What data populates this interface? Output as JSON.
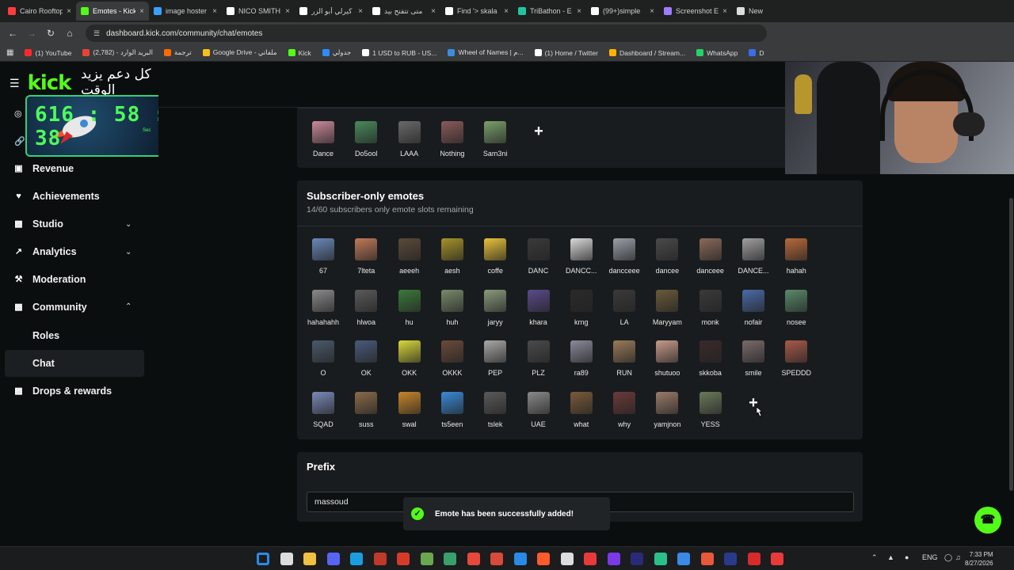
{
  "browser": {
    "tabs": [
      {
        "label": "Cairo Rooftop",
        "color": "#ff3b3b",
        "active": false
      },
      {
        "label": "Emotes - Kick",
        "color": "#53fc18",
        "active": true
      },
      {
        "label": "image hoster",
        "color": "#3aa0ff",
        "active": false
      },
      {
        "label": "NICO SMITH",
        "color": "#ffffff",
        "active": false
      },
      {
        "label": "كيرلي أبو الزر",
        "color": "#ffffff",
        "active": false
      },
      {
        "label": "متى تتفتح بيد",
        "color": "#ffffff",
        "active": false
      },
      {
        "label": "Find '> skala",
        "color": "#ffffff",
        "active": false
      },
      {
        "label": "TriBathon - E",
        "color": "#20c4a0",
        "active": false
      },
      {
        "label": "(99+)simple",
        "color": "#ffffff",
        "active": false
      },
      {
        "label": "Screenshot E",
        "color": "#a07cff",
        "active": false
      },
      {
        "label": "New",
        "color": "#dddddd",
        "active": false
      }
    ],
    "url": "dashboard.kick.com/community/chat/emotes",
    "bookmarks": [
      {
        "label": "(1) YouTube",
        "color": "#ff2a2a"
      },
      {
        "label": "(2,782) - البريد الوارد",
        "color": "#ea4335"
      },
      {
        "label": "ترجمة",
        "color": "#ff6a00"
      },
      {
        "label": "Google Drive - ملفاتي",
        "color": "#f7c11a"
      },
      {
        "label": "Kick",
        "color": "#53fc18"
      },
      {
        "label": "جدولي",
        "color": "#2d8cff"
      },
      {
        "label": "1 USD to RUB - US...",
        "color": "#ffffff"
      },
      {
        "label": "Wheel of Names | م...",
        "color": "#3a8dde"
      },
      {
        "label": "(1) Home / Twitter",
        "color": "#ffffff"
      },
      {
        "label": "Dashboard / Stream...",
        "color": "#ffb400"
      },
      {
        "label": "WhatsApp",
        "color": "#25d366"
      },
      {
        "label": "D",
        "color": "#3a6ee8"
      }
    ]
  },
  "sidebar": {
    "logo": "kick",
    "overlay_text": "كل دعم يزيد الوقت",
    "timer": {
      "digits": "616 : 58 : 38",
      "sec_label": "Sec"
    },
    "items": [
      {
        "label": "Revenue",
        "icon": "dollar-icon"
      },
      {
        "label": "Achievements",
        "icon": "trophy-icon"
      },
      {
        "label": "Studio",
        "icon": "video-icon"
      },
      {
        "label": "Analytics",
        "icon": "chart-icon"
      },
      {
        "label": "Moderation",
        "icon": "hammer-icon"
      },
      {
        "label": "Community",
        "icon": "users-icon"
      },
      {
        "label": "Drops & rewards",
        "icon": "gift-icon"
      }
    ],
    "community_sub": [
      "Roles",
      "Chat"
    ]
  },
  "top_emotes": [
    {
      "name": "Dance",
      "color": "#c98a9a"
    },
    {
      "name": "Do5ool",
      "color": "#4a8a5a"
    },
    {
      "name": "LAAA",
      "color": "#6a6a6a"
    },
    {
      "name": "Nothing",
      "color": "#8a5a5a"
    },
    {
      "name": "Sam3ni",
      "color": "#7aa06a"
    }
  ],
  "subscriber_panel": {
    "title": "Subscriber-only emotes",
    "subtitle": "14/60 subscribers only emote slots remaining",
    "emotes": [
      {
        "name": "67",
        "color": "#6a88b8"
      },
      {
        "name": "7lteta",
        "color": "#c07a5a"
      },
      {
        "name": "aeeeh",
        "color": "#5a4a3a"
      },
      {
        "name": "aesh",
        "color": "#a8922a"
      },
      {
        "name": "coffe",
        "color": "#e8c23a"
      },
      {
        "name": "DANC",
        "color": "#3a3a3a"
      },
      {
        "name": "DANCC...",
        "color": "#d8d8d8"
      },
      {
        "name": "dancceee",
        "color": "#9aa0a8"
      },
      {
        "name": "dancee",
        "color": "#4a4a4a"
      },
      {
        "name": "danceee",
        "color": "#8a6a5a"
      },
      {
        "name": "DANCE...",
        "color": "#a0a0a0"
      },
      {
        "name": "hahah",
        "color": "#b86a3a"
      },
      {
        "name": "hahahahh",
        "color": "#8a8a8a"
      },
      {
        "name": "hlwoa",
        "color": "#5a5a5a"
      },
      {
        "name": "hu",
        "color": "#3a7a3a"
      },
      {
        "name": "huh",
        "color": "#7a8a6a"
      },
      {
        "name": "jaryy",
        "color": "#8a9a7a"
      },
      {
        "name": "khara",
        "color": "#5a4a8a"
      },
      {
        "name": "krng",
        "color": "#2a2a2a"
      },
      {
        "name": "LA",
        "color": "#3a3a3a"
      },
      {
        "name": "Maryyam",
        "color": "#6a5a3a"
      },
      {
        "name": "monk",
        "color": "#3a3a3a"
      },
      {
        "name": "nofair",
        "color": "#4a6aa8"
      },
      {
        "name": "nosee",
        "color": "#5a8a6a"
      },
      {
        "name": "O",
        "color": "#4a5a6a"
      },
      {
        "name": "OK",
        "color": "#4a5a7a"
      },
      {
        "name": "OKK",
        "color": "#d8d83a"
      },
      {
        "name": "OKKK",
        "color": "#6a4a3a"
      },
      {
        "name": "PEP",
        "color": "#a8a8a8"
      },
      {
        "name": "PLZ",
        "color": "#4a4a4a"
      },
      {
        "name": "ra89",
        "color": "#8a8a9a"
      },
      {
        "name": "RUN",
        "color": "#9a7a5a"
      },
      {
        "name": "shutuoo",
        "color": "#c89a8a"
      },
      {
        "name": "skkoba",
        "color": "#3a2a2a"
      },
      {
        "name": "smile",
        "color": "#7a6a6a"
      },
      {
        "name": "SPEDDD",
        "color": "#a85a4a"
      },
      {
        "name": "SQAD",
        "color": "#7a8ab8"
      },
      {
        "name": "suss",
        "color": "#8a6a4a"
      },
      {
        "name": "swal",
        "color": "#c8862a"
      },
      {
        "name": "ts5een",
        "color": "#3a8ad8"
      },
      {
        "name": "tslek",
        "color": "#5a5a5a"
      },
      {
        "name": "UAE",
        "color": "#8a8a8a"
      },
      {
        "name": "what",
        "color": "#7a5a3a"
      },
      {
        "name": "why",
        "color": "#6a3a3a"
      },
      {
        "name": "yamjnon",
        "color": "#9a7a6a"
      },
      {
        "name": "YESS",
        "color": "#6a7a5a"
      }
    ]
  },
  "prefix_panel": {
    "title": "Prefix",
    "value": "massoud"
  },
  "toast": {
    "message": "Emote has been successfully added!"
  },
  "taskbar": {
    "lang": "ENG",
    "time": "7:33 PM",
    "date": "8/27/2026"
  },
  "colors": {
    "accent": "#53fc18",
    "panel": "#191c1e",
    "background": "#0b0e0f"
  }
}
